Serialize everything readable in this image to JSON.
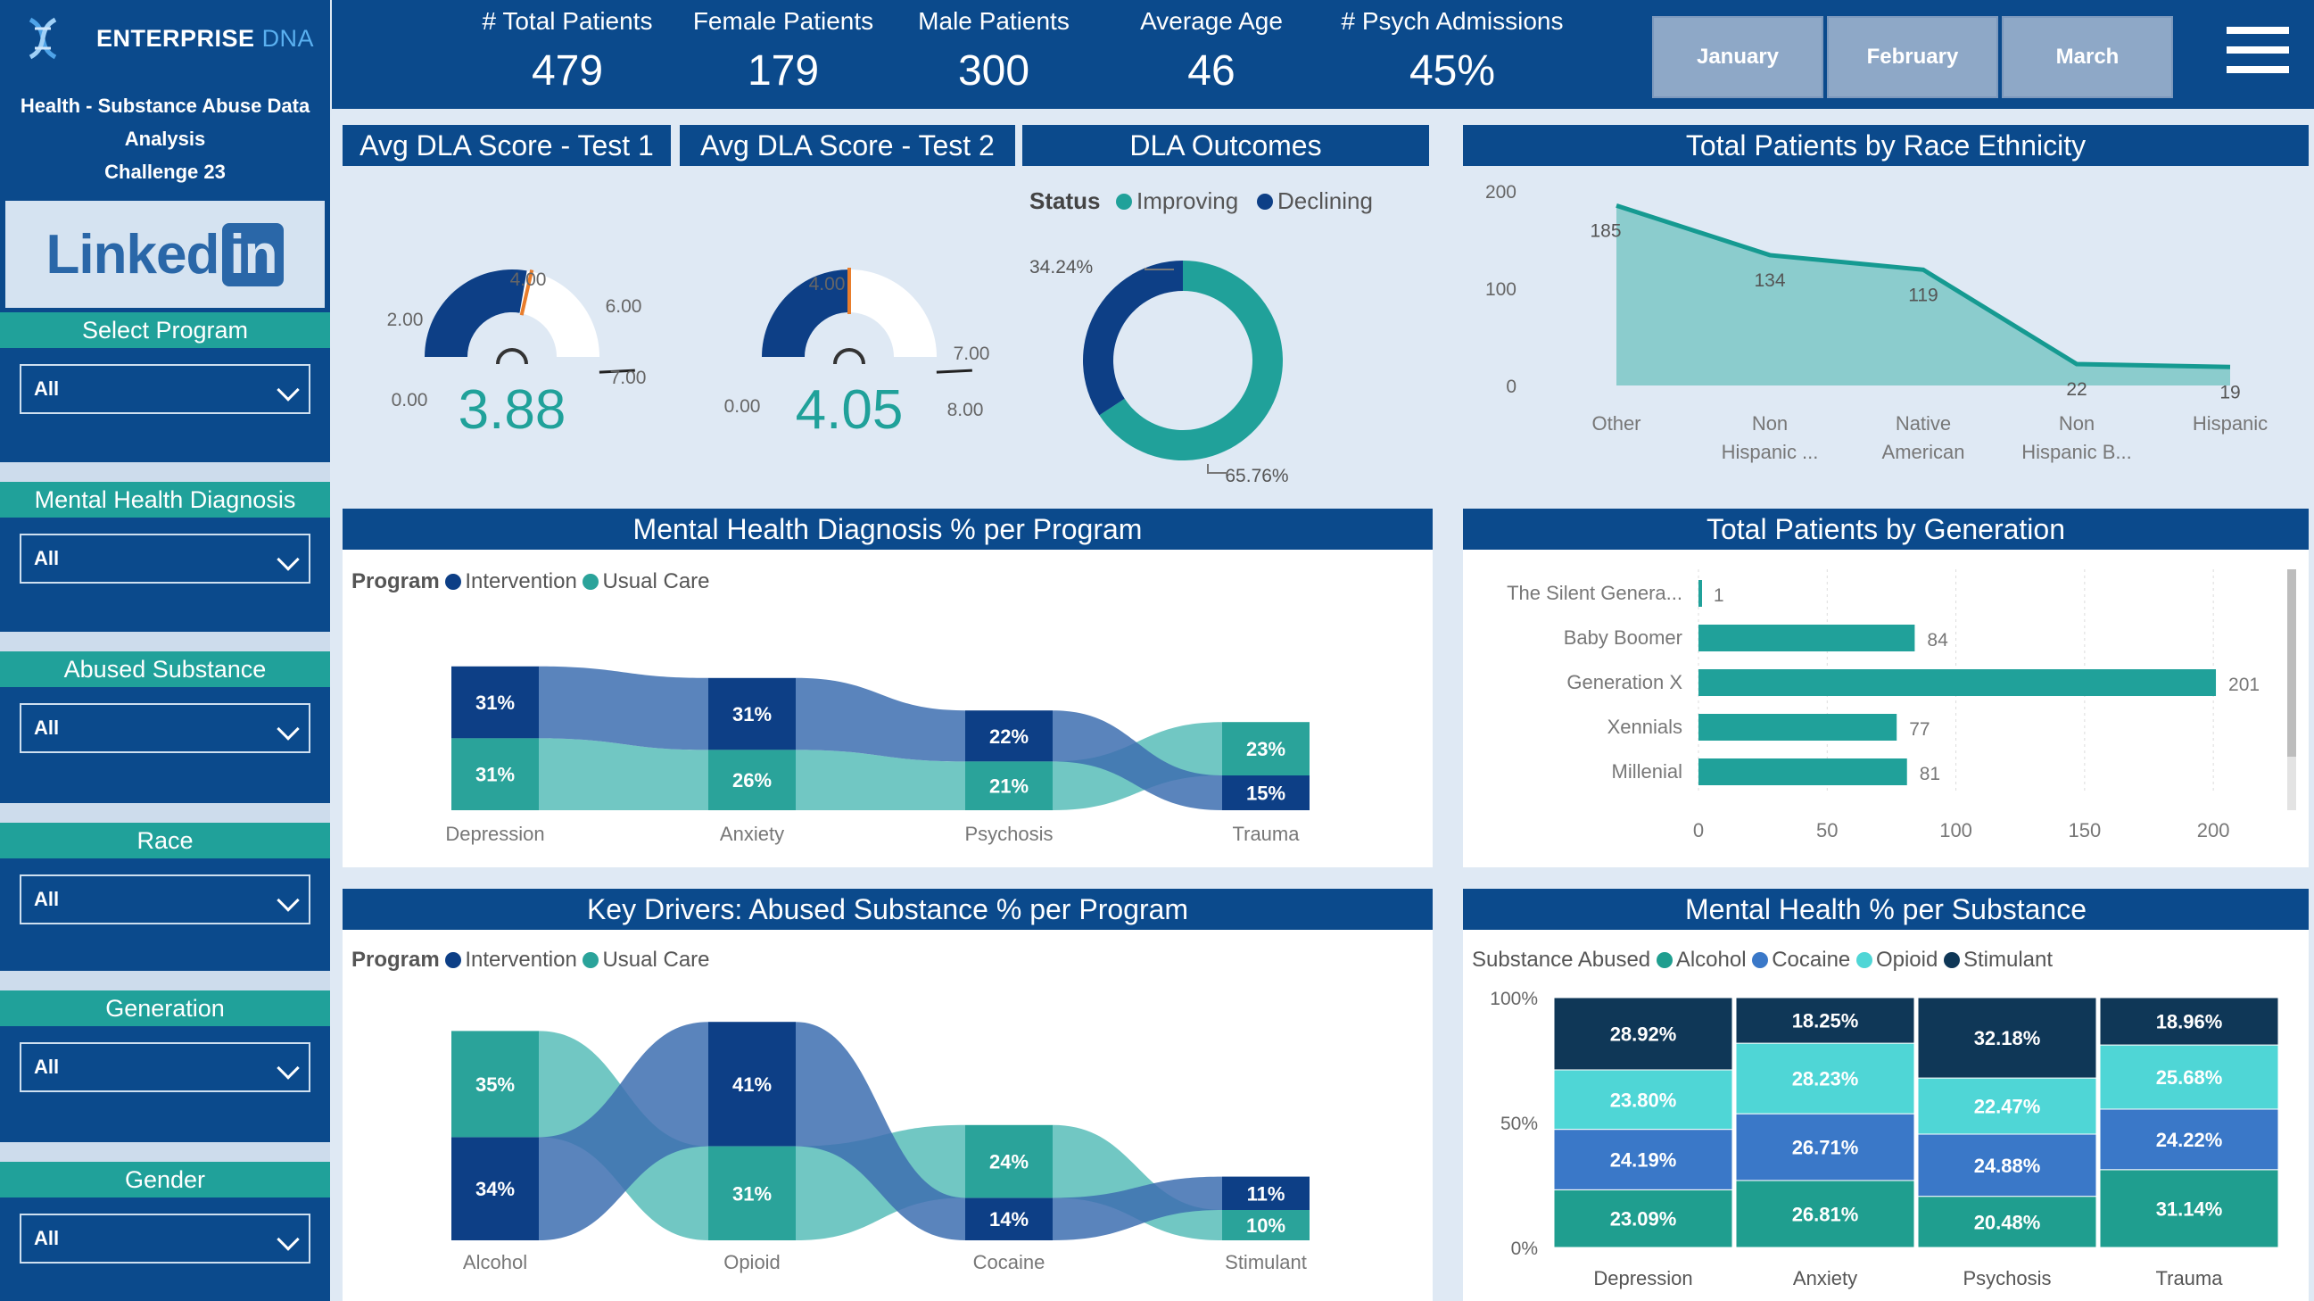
{
  "brand": {
    "name_main": "ENTERPRISE",
    "name_accent": "DNA",
    "subtitle_line1": "Health - Substance Abuse Data",
    "subtitle_line2": "Analysis",
    "subtitle_line3": "Challenge 23"
  },
  "linkedin": {
    "text": "Linked",
    "box": "in"
  },
  "filters": [
    {
      "title": "Select Program",
      "value": "All"
    },
    {
      "title": "Mental Health Diagnosis",
      "value": "All"
    },
    {
      "title": "Abused Substance",
      "value": "All"
    },
    {
      "title": "Race",
      "value": "All"
    },
    {
      "title": "Generation",
      "value": "All"
    },
    {
      "title": "Gender",
      "value": "All"
    }
  ],
  "kpis": [
    {
      "label": "# Total Patients",
      "value": "479"
    },
    {
      "label": "Female Patients",
      "value": "179"
    },
    {
      "label": "Male Patients",
      "value": "300"
    },
    {
      "label": "Average Age",
      "value": "46"
    },
    {
      "label": "# Psych Admissions",
      "value": "45%"
    }
  ],
  "months": [
    "January",
    "February",
    "March"
  ],
  "colors": {
    "navy": "#0b4a8c",
    "teal": "#20a19a",
    "intervention": "#0d3f86",
    "usual_care": "#2aa39a",
    "alcohol": "#1f9e8f",
    "cocaine": "#3a78c8",
    "opioid": "#4fd6d6",
    "stimulant": "#0f3757"
  },
  "gauge1": {
    "title": "Avg DLA Score - Test 1",
    "value": "3.88",
    "ticks": [
      "0.00",
      "2.00",
      "4.00",
      "6.00",
      "7.00"
    ],
    "value_num": 3.88,
    "max": 7.0,
    "target": 4.0
  },
  "gauge2": {
    "title": "Avg DLA Score - Test 2",
    "value": "4.05",
    "ticks": [
      "0.00",
      "4.00",
      "7.00",
      "8.00"
    ],
    "value_num": 4.05,
    "max": 8.0,
    "target": 4.0
  },
  "dla": {
    "title": "DLA Outcomes",
    "legend_title": "Status",
    "legend": [
      "Improving",
      "Declining"
    ],
    "label_declining": "34.24%",
    "label_improving": "65.76%"
  },
  "race": {
    "title": "Total Patients by Race Ethnicity",
    "yticks": [
      "200",
      "100",
      "0"
    ]
  },
  "mh_program": {
    "title": "Mental Health Diagnosis % per Program",
    "legend_title": "Program",
    "legend": [
      "Intervention",
      "Usual Care"
    ]
  },
  "generation": {
    "title": "Total Patients by Generation",
    "xticks": [
      "0",
      "50",
      "100",
      "150",
      "200"
    ]
  },
  "substance_program": {
    "title": "Key Drivers: Abused Substance % per Program",
    "legend_title": "Program",
    "legend": [
      "Intervention",
      "Usual Care"
    ]
  },
  "mh_substance": {
    "title": "Mental Health % per Substance",
    "legend_title": "Substance Abused",
    "legend": [
      "Alcohol",
      "Cocaine",
      "Opioid",
      "Stimulant"
    ],
    "yticks": [
      "100%",
      "50%",
      "0%"
    ]
  },
  "chart_data": [
    {
      "type": "area",
      "title": "Total Patients by Race Ethnicity",
      "categories": [
        "Other",
        "Non Hispanic ...",
        "Native American",
        "Non Hispanic B...",
        "Hispanic"
      ],
      "values": [
        185,
        134,
        119,
        22,
        19
      ],
      "ylim": [
        0,
        200
      ]
    },
    {
      "type": "bar",
      "title": "Total Patients by Generation",
      "orientation": "horizontal",
      "categories": [
        "The Silent Genera...",
        "Baby Boomer",
        "Generation X",
        "Xennials",
        "Millenial"
      ],
      "values": [
        1,
        84,
        201,
        77,
        81
      ],
      "xlim": [
        0,
        210
      ]
    },
    {
      "type": "pie",
      "title": "DLA Outcomes",
      "categories": [
        "Improving",
        "Declining"
      ],
      "values": [
        65.76,
        34.24
      ]
    },
    {
      "type": "bar",
      "title": "Mental Health Diagnosis % per Program",
      "stacked": true,
      "categories": [
        "Depression",
        "Anxiety",
        "Psychosis",
        "Trauma"
      ],
      "series": [
        {
          "name": "Intervention",
          "values": [
            31,
            31,
            22,
            15
          ]
        },
        {
          "name": "Usual Care",
          "values": [
            31,
            26,
            21,
            23
          ]
        }
      ]
    },
    {
      "type": "bar",
      "title": "Key Drivers: Abused Substance % per Program",
      "stacked": true,
      "categories": [
        "Alcohol",
        "Opioid",
        "Cocaine",
        "Stimulant"
      ],
      "series": [
        {
          "name": "Intervention",
          "values": [
            34,
            41,
            14,
            11
          ]
        },
        {
          "name": "Usual Care",
          "values": [
            35,
            31,
            24,
            10
          ]
        }
      ]
    },
    {
      "type": "bar",
      "title": "Mental Health % per Substance",
      "stacked": true,
      "categories": [
        "Depression",
        "Anxiety",
        "Psychosis",
        "Trauma"
      ],
      "series": [
        {
          "name": "Alcohol",
          "values": [
            23.09,
            26.81,
            20.48,
            31.14
          ],
          "labels": [
            "23.09%",
            "26.81%",
            "20.48%",
            "31.14%"
          ]
        },
        {
          "name": "Cocaine",
          "values": [
            24.19,
            26.71,
            24.88,
            24.22
          ],
          "labels": [
            "24.19%",
            "26.71%",
            "24.88%",
            "24.22%"
          ]
        },
        {
          "name": "Opioid",
          "values": [
            23.8,
            28.23,
            22.47,
            25.68
          ],
          "labels": [
            "23.80%",
            "28.23%",
            "22.47%",
            "25.68%"
          ]
        },
        {
          "name": "Stimulant",
          "values": [
            28.92,
            18.25,
            32.18,
            18.96
          ],
          "labels": [
            "28.92%",
            "18.25%",
            "32.18%",
            "18.96%"
          ]
        }
      ],
      "ylim": [
        0,
        100
      ]
    }
  ]
}
